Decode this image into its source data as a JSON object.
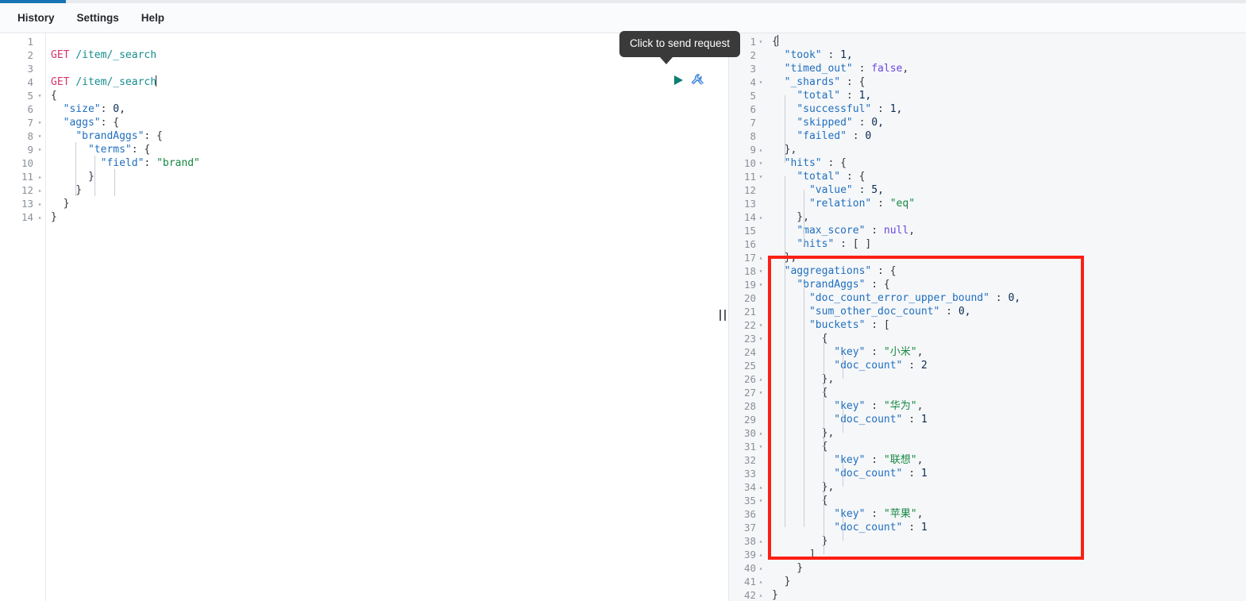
{
  "window": {
    "tab_accent_color": "#1775b5"
  },
  "menubar": {
    "items": [
      {
        "label": "History",
        "name": "menu-history"
      },
      {
        "label": "Settings",
        "name": "menu-settings"
      },
      {
        "label": "Help",
        "name": "menu-help"
      }
    ]
  },
  "tooltip": {
    "text": "Click to send request"
  },
  "icons": {
    "play": "play-triangle-icon",
    "wrench": "wrench-icon",
    "splitter": "splitter-handle-icon",
    "fold_open": "▾",
    "fold_close": "▴"
  },
  "request_editor": {
    "name": "request-console-editor",
    "active_line": 4,
    "selection_start_line": 5,
    "selection_end_line": 14,
    "lines": [
      {
        "n": 1,
        "fold": "",
        "tokens": []
      },
      {
        "n": 2,
        "fold": "",
        "tokens": [
          {
            "c": "t-method",
            "t": "GET"
          },
          {
            "c": "t-plain",
            "t": " "
          },
          {
            "c": "t-url",
            "t": "/item/_search"
          }
        ]
      },
      {
        "n": 3,
        "fold": "",
        "tokens": []
      },
      {
        "n": 4,
        "fold": "",
        "tokens": [
          {
            "c": "t-method",
            "t": "GET"
          },
          {
            "c": "t-plain",
            "t": " "
          },
          {
            "c": "t-url",
            "t": "/item/_search"
          }
        ],
        "caret": true
      },
      {
        "n": 5,
        "fold": "▾",
        "tokens": [
          {
            "c": "t-punct",
            "t": "{"
          }
        ]
      },
      {
        "n": 6,
        "fold": "",
        "tokens": [
          {
            "c": "t-plain",
            "t": "  "
          },
          {
            "c": "t-key",
            "t": "\"size\""
          },
          {
            "c": "t-punct",
            "t": ": "
          },
          {
            "c": "t-num",
            "t": "0,"
          }
        ]
      },
      {
        "n": 7,
        "fold": "▾",
        "tokens": [
          {
            "c": "t-plain",
            "t": "  "
          },
          {
            "c": "t-key",
            "t": "\"aggs\""
          },
          {
            "c": "t-punct",
            "t": ": {"
          }
        ]
      },
      {
        "n": 8,
        "fold": "▾",
        "tokens": [
          {
            "c": "t-plain",
            "t": "    "
          },
          {
            "c": "t-key",
            "t": "\"brandAggs\""
          },
          {
            "c": "t-punct",
            "t": ": {"
          }
        ]
      },
      {
        "n": 9,
        "fold": "▾",
        "tokens": [
          {
            "c": "t-plain",
            "t": "      "
          },
          {
            "c": "t-key",
            "t": "\"terms\""
          },
          {
            "c": "t-punct",
            "t": ": {"
          }
        ]
      },
      {
        "n": 10,
        "fold": "",
        "tokens": [
          {
            "c": "t-plain",
            "t": "        "
          },
          {
            "c": "t-key",
            "t": "\"field\""
          },
          {
            "c": "t-punct",
            "t": ": "
          },
          {
            "c": "t-str",
            "t": "\"brand\""
          }
        ]
      },
      {
        "n": 11,
        "fold": "▴",
        "tokens": [
          {
            "c": "t-punct",
            "t": "      }"
          }
        ]
      },
      {
        "n": 12,
        "fold": "▴",
        "tokens": [
          {
            "c": "t-punct",
            "t": "    }"
          }
        ]
      },
      {
        "n": 13,
        "fold": "▴",
        "tokens": [
          {
            "c": "t-punct",
            "t": "  }"
          }
        ]
      },
      {
        "n": 14,
        "fold": "▴",
        "tokens": [
          {
            "c": "t-punct",
            "t": "}"
          }
        ]
      }
    ]
  },
  "response_editor": {
    "name": "response-output-editor",
    "active_line": 1,
    "lines": [
      {
        "n": 1,
        "fold": "▾",
        "tokens": [
          {
            "c": "t-punct",
            "t": "{"
          }
        ],
        "caret": true
      },
      {
        "n": 2,
        "fold": "",
        "tokens": [
          {
            "c": "t-plain",
            "t": "  "
          },
          {
            "c": "t-key",
            "t": "\"took\""
          },
          {
            "c": "t-punct",
            "t": " : "
          },
          {
            "c": "t-num",
            "t": "1,"
          }
        ]
      },
      {
        "n": 3,
        "fold": "",
        "tokens": [
          {
            "c": "t-plain",
            "t": "  "
          },
          {
            "c": "t-key",
            "t": "\"timed_out\""
          },
          {
            "c": "t-punct",
            "t": " : "
          },
          {
            "c": "t-bool",
            "t": "false"
          },
          {
            "c": "t-punct",
            "t": ","
          }
        ]
      },
      {
        "n": 4,
        "fold": "▾",
        "tokens": [
          {
            "c": "t-plain",
            "t": "  "
          },
          {
            "c": "t-key",
            "t": "\"_shards\""
          },
          {
            "c": "t-punct",
            "t": " : {"
          }
        ]
      },
      {
        "n": 5,
        "fold": "",
        "tokens": [
          {
            "c": "t-plain",
            "t": "    "
          },
          {
            "c": "t-key",
            "t": "\"total\""
          },
          {
            "c": "t-punct",
            "t": " : "
          },
          {
            "c": "t-num",
            "t": "1,"
          }
        ]
      },
      {
        "n": 6,
        "fold": "",
        "tokens": [
          {
            "c": "t-plain",
            "t": "    "
          },
          {
            "c": "t-key",
            "t": "\"successful\""
          },
          {
            "c": "t-punct",
            "t": " : "
          },
          {
            "c": "t-num",
            "t": "1,"
          }
        ]
      },
      {
        "n": 7,
        "fold": "",
        "tokens": [
          {
            "c": "t-plain",
            "t": "    "
          },
          {
            "c": "t-key",
            "t": "\"skipped\""
          },
          {
            "c": "t-punct",
            "t": " : "
          },
          {
            "c": "t-num",
            "t": "0,"
          }
        ]
      },
      {
        "n": 8,
        "fold": "",
        "tokens": [
          {
            "c": "t-plain",
            "t": "    "
          },
          {
            "c": "t-key",
            "t": "\"failed\""
          },
          {
            "c": "t-punct",
            "t": " : "
          },
          {
            "c": "t-num",
            "t": "0"
          }
        ]
      },
      {
        "n": 9,
        "fold": "▴",
        "tokens": [
          {
            "c": "t-punct",
            "t": "  },"
          }
        ]
      },
      {
        "n": 10,
        "fold": "▾",
        "tokens": [
          {
            "c": "t-plain",
            "t": "  "
          },
          {
            "c": "t-key",
            "t": "\"hits\""
          },
          {
            "c": "t-punct",
            "t": " : {"
          }
        ]
      },
      {
        "n": 11,
        "fold": "▾",
        "tokens": [
          {
            "c": "t-plain",
            "t": "    "
          },
          {
            "c": "t-key",
            "t": "\"total\""
          },
          {
            "c": "t-punct",
            "t": " : {"
          }
        ]
      },
      {
        "n": 12,
        "fold": "",
        "tokens": [
          {
            "c": "t-plain",
            "t": "      "
          },
          {
            "c": "t-key",
            "t": "\"value\""
          },
          {
            "c": "t-punct",
            "t": " : "
          },
          {
            "c": "t-num",
            "t": "5,"
          }
        ]
      },
      {
        "n": 13,
        "fold": "",
        "tokens": [
          {
            "c": "t-plain",
            "t": "      "
          },
          {
            "c": "t-key",
            "t": "\"relation\""
          },
          {
            "c": "t-punct",
            "t": " : "
          },
          {
            "c": "t-str",
            "t": "\"eq\""
          }
        ]
      },
      {
        "n": 14,
        "fold": "▴",
        "tokens": [
          {
            "c": "t-punct",
            "t": "    },"
          }
        ]
      },
      {
        "n": 15,
        "fold": "",
        "tokens": [
          {
            "c": "t-plain",
            "t": "    "
          },
          {
            "c": "t-key",
            "t": "\"max_score\""
          },
          {
            "c": "t-punct",
            "t": " : "
          },
          {
            "c": "t-null",
            "t": "null"
          },
          {
            "c": "t-punct",
            "t": ","
          }
        ]
      },
      {
        "n": 16,
        "fold": "",
        "tokens": [
          {
            "c": "t-plain",
            "t": "    "
          },
          {
            "c": "t-key",
            "t": "\"hits\""
          },
          {
            "c": "t-punct",
            "t": " : [ ]"
          }
        ]
      },
      {
        "n": 17,
        "fold": "▴",
        "tokens": [
          {
            "c": "t-punct",
            "t": "  },"
          }
        ]
      },
      {
        "n": 18,
        "fold": "▾",
        "tokens": [
          {
            "c": "t-plain",
            "t": "  "
          },
          {
            "c": "t-key",
            "t": "\"aggregations\""
          },
          {
            "c": "t-punct",
            "t": " : {"
          }
        ]
      },
      {
        "n": 19,
        "fold": "▾",
        "tokens": [
          {
            "c": "t-plain",
            "t": "    "
          },
          {
            "c": "t-key",
            "t": "\"brandAggs\""
          },
          {
            "c": "t-punct",
            "t": " : {"
          }
        ]
      },
      {
        "n": 20,
        "fold": "",
        "tokens": [
          {
            "c": "t-plain",
            "t": "      "
          },
          {
            "c": "t-key",
            "t": "\"doc_count_error_upper_bound\""
          },
          {
            "c": "t-punct",
            "t": " : "
          },
          {
            "c": "t-num",
            "t": "0,"
          }
        ]
      },
      {
        "n": 21,
        "fold": "",
        "tokens": [
          {
            "c": "t-plain",
            "t": "      "
          },
          {
            "c": "t-key",
            "t": "\"sum_other_doc_count\""
          },
          {
            "c": "t-punct",
            "t": " : "
          },
          {
            "c": "t-num",
            "t": "0,"
          }
        ]
      },
      {
        "n": 22,
        "fold": "▾",
        "tokens": [
          {
            "c": "t-plain",
            "t": "      "
          },
          {
            "c": "t-key",
            "t": "\"buckets\""
          },
          {
            "c": "t-punct",
            "t": " : ["
          }
        ]
      },
      {
        "n": 23,
        "fold": "▾",
        "tokens": [
          {
            "c": "t-punct",
            "t": "        {"
          }
        ]
      },
      {
        "n": 24,
        "fold": "",
        "tokens": [
          {
            "c": "t-plain",
            "t": "          "
          },
          {
            "c": "t-key",
            "t": "\"key\""
          },
          {
            "c": "t-punct",
            "t": " : "
          },
          {
            "c": "t-str",
            "t": "\"小米\""
          },
          {
            "c": "t-punct",
            "t": ","
          }
        ]
      },
      {
        "n": 25,
        "fold": "",
        "tokens": [
          {
            "c": "t-plain",
            "t": "          "
          },
          {
            "c": "t-key",
            "t": "\"doc_count\""
          },
          {
            "c": "t-punct",
            "t": " : "
          },
          {
            "c": "t-num",
            "t": "2"
          }
        ]
      },
      {
        "n": 26,
        "fold": "▴",
        "tokens": [
          {
            "c": "t-punct",
            "t": "        },"
          }
        ]
      },
      {
        "n": 27,
        "fold": "▾",
        "tokens": [
          {
            "c": "t-punct",
            "t": "        {"
          }
        ]
      },
      {
        "n": 28,
        "fold": "",
        "tokens": [
          {
            "c": "t-plain",
            "t": "          "
          },
          {
            "c": "t-key",
            "t": "\"key\""
          },
          {
            "c": "t-punct",
            "t": " : "
          },
          {
            "c": "t-str",
            "t": "\"华为\""
          },
          {
            "c": "t-punct",
            "t": ","
          }
        ]
      },
      {
        "n": 29,
        "fold": "",
        "tokens": [
          {
            "c": "t-plain",
            "t": "          "
          },
          {
            "c": "t-key",
            "t": "\"doc_count\""
          },
          {
            "c": "t-punct",
            "t": " : "
          },
          {
            "c": "t-num",
            "t": "1"
          }
        ]
      },
      {
        "n": 30,
        "fold": "▴",
        "tokens": [
          {
            "c": "t-punct",
            "t": "        },"
          }
        ]
      },
      {
        "n": 31,
        "fold": "▾",
        "tokens": [
          {
            "c": "t-punct",
            "t": "        {"
          }
        ]
      },
      {
        "n": 32,
        "fold": "",
        "tokens": [
          {
            "c": "t-plain",
            "t": "          "
          },
          {
            "c": "t-key",
            "t": "\"key\""
          },
          {
            "c": "t-punct",
            "t": " : "
          },
          {
            "c": "t-str",
            "t": "\"联想\""
          },
          {
            "c": "t-punct",
            "t": ","
          }
        ]
      },
      {
        "n": 33,
        "fold": "",
        "tokens": [
          {
            "c": "t-plain",
            "t": "          "
          },
          {
            "c": "t-key",
            "t": "\"doc_count\""
          },
          {
            "c": "t-punct",
            "t": " : "
          },
          {
            "c": "t-num",
            "t": "1"
          }
        ]
      },
      {
        "n": 34,
        "fold": "▴",
        "tokens": [
          {
            "c": "t-punct",
            "t": "        },"
          }
        ]
      },
      {
        "n": 35,
        "fold": "▾",
        "tokens": [
          {
            "c": "t-punct",
            "t": "        {"
          }
        ]
      },
      {
        "n": 36,
        "fold": "",
        "tokens": [
          {
            "c": "t-plain",
            "t": "          "
          },
          {
            "c": "t-key",
            "t": "\"key\""
          },
          {
            "c": "t-punct",
            "t": " : "
          },
          {
            "c": "t-str",
            "t": "\"苹果\""
          },
          {
            "c": "t-punct",
            "t": ","
          }
        ]
      },
      {
        "n": 37,
        "fold": "",
        "tokens": [
          {
            "c": "t-plain",
            "t": "          "
          },
          {
            "c": "t-key",
            "t": "\"doc_count\""
          },
          {
            "c": "t-punct",
            "t": " : "
          },
          {
            "c": "t-num",
            "t": "1"
          }
        ]
      },
      {
        "n": 38,
        "fold": "▴",
        "tokens": [
          {
            "c": "t-punct",
            "t": "        }"
          }
        ]
      },
      {
        "n": 39,
        "fold": "▴",
        "tokens": [
          {
            "c": "t-punct",
            "t": "      ]"
          }
        ]
      },
      {
        "n": 40,
        "fold": "▴",
        "tokens": [
          {
            "c": "t-punct",
            "t": "    }"
          }
        ]
      },
      {
        "n": 41,
        "fold": "▴",
        "tokens": [
          {
            "c": "t-punct",
            "t": "  }"
          }
        ]
      },
      {
        "n": 42,
        "fold": "▴",
        "tokens": [
          {
            "c": "t-punct",
            "t": "}"
          }
        ]
      }
    ]
  },
  "annotation": {
    "name": "aggregations-highlight-box",
    "color": "#fc2015"
  }
}
